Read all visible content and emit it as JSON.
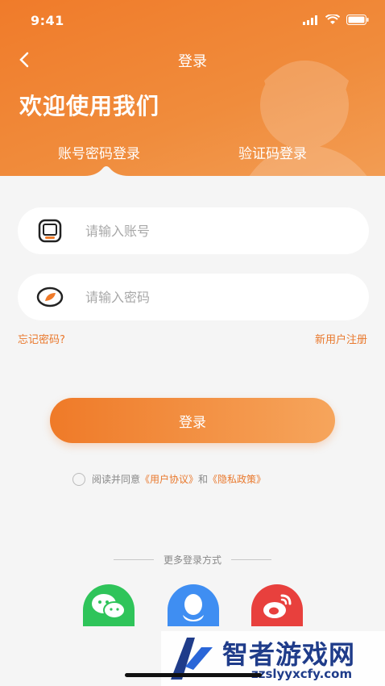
{
  "status": {
    "time": "9:41"
  },
  "nav": {
    "title": "登录"
  },
  "welcome": "欢迎使用我们",
  "tabs": {
    "account": "账号密码登录",
    "code": "验证码登录"
  },
  "form": {
    "account_placeholder": "请输入账号",
    "password_placeholder": "请输入密码",
    "forgot": "忘记密码?",
    "register": "新用户注册",
    "login_button": "登录"
  },
  "agreement": {
    "prefix": "阅读并同意",
    "user_agreement": "《用户协议》",
    "and": "和",
    "privacy_policy": "《隐私政策》"
  },
  "more_login": "更多登录方式",
  "social": [
    "wechat-icon",
    "qq-icon",
    "weibo-icon"
  ],
  "watermark": {
    "name": "智者游戏网",
    "url": "zzslyyxcfy.com"
  },
  "colors": {
    "accent": "#f07b2a",
    "wechat": "#2fc45a",
    "qq": "#3f8ef2",
    "weibo": "#e8403d"
  }
}
